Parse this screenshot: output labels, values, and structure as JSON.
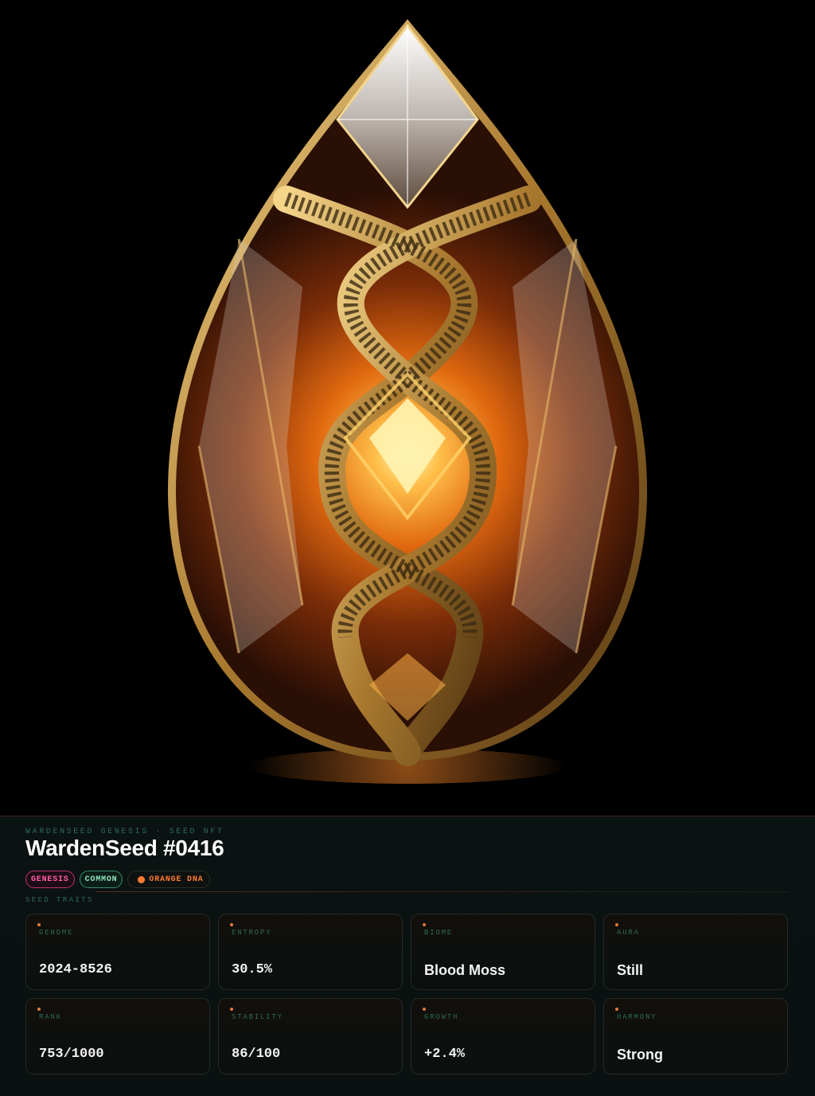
{
  "collection_label": "WARDENSEED GENESIS · SEED NFT",
  "title": "WardenSeed #0416",
  "badges": {
    "genesis": "GENESIS",
    "rarity": "COMMON",
    "dna": "ORANGE DNA"
  },
  "traits_label": "SEED TRAITS",
  "traits": [
    {
      "label": "GENOME",
      "value": "2024-8526"
    },
    {
      "label": "ENTROPY",
      "value": "30.5%"
    },
    {
      "label": "BIOME",
      "value": "Blood Moss"
    },
    {
      "label": "AURA",
      "value": "Still"
    },
    {
      "label": "RANK",
      "value": "753/1000"
    },
    {
      "label": "STABILITY",
      "value": "86/100"
    },
    {
      "label": "GROWTH",
      "value": "+2.4%"
    },
    {
      "label": "HARMONY",
      "value": "Strong"
    }
  ],
  "colors": {
    "accent_orange": "#ff7a33",
    "genesis_pink": "#ff5ea6",
    "common_green": "#8fe3bd",
    "label_teal": "#2f6b58"
  }
}
